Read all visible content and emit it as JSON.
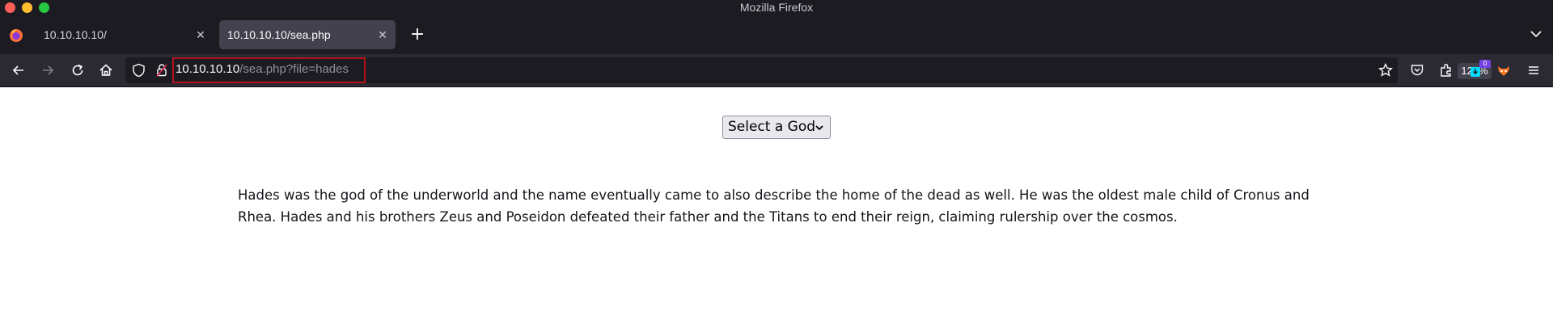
{
  "window": {
    "title": "Mozilla Firefox"
  },
  "tabs": [
    {
      "label": "10.10.10.10/",
      "active": false
    },
    {
      "label": "10.10.10.10/sea.php",
      "active": true
    }
  ],
  "toolbar": {
    "url_host": "10.10.10.10",
    "url_path": "/sea.php?file=hades",
    "zoom": "120%",
    "extension_badge": "0",
    "icons": [
      "back-icon",
      "forward-icon",
      "reload-icon",
      "home-icon",
      "shield-icon",
      "lock-icon",
      "bookmark-star-icon",
      "pocket-icon",
      "extensions-icon",
      "downloads-icon",
      "fox-extension-icon",
      "menu-icon"
    ]
  },
  "page": {
    "select": {
      "selected": "Select a God"
    },
    "description": "Hades was the god of the underworld and the name eventually came to also describe the home of the dead as well. He was the oldest male child of Cronus and Rhea. Hades and his brothers Zeus and Poseidon defeated their father and the Titans to end their reign, claiming rulership over the cosmos."
  },
  "colors": {
    "chrome_dark": "#1c1b22",
    "toolbar": "#2b2a33",
    "active_tab": "#42414d",
    "url_highlight": "#b3121a",
    "page_bg": "#ffffff"
  }
}
